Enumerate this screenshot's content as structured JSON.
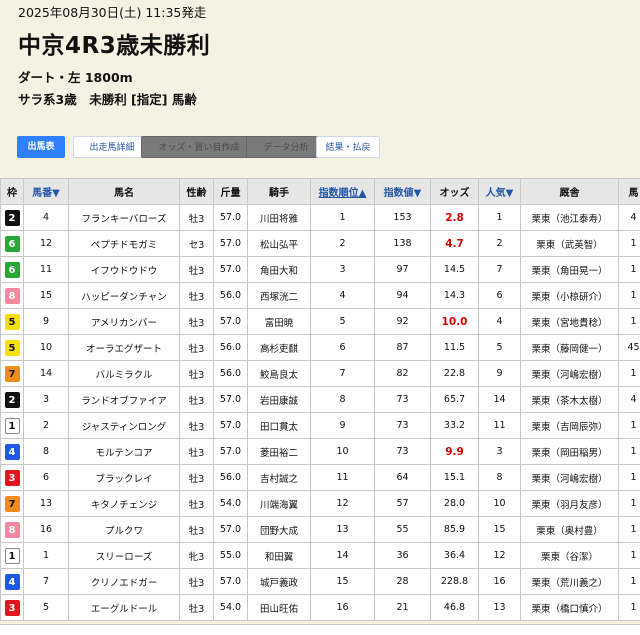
{
  "race": {
    "datetime": "2025年08月30日(土) 11:35発走",
    "title": "中京4R3歳未勝利",
    "course": "ダート・左 1800m",
    "conditions": "サラ系3歳　未勝利 [指定] 馬齢"
  },
  "tabs": [
    {
      "label": "出馬表"
    },
    {
      "label": "出走馬詳細"
    },
    {
      "label": "オッズ・買い目作成"
    },
    {
      "label": "データ分析"
    },
    {
      "label": "結果・払戻"
    }
  ],
  "columns": {
    "waku": "枠",
    "umaban": "馬番▼",
    "name": "馬名",
    "sexage": "性齢",
    "weight": "斤量",
    "jockey": "騎手",
    "index_rank": "指数順位▲",
    "index": "指数値▼",
    "odds": "オッズ",
    "pop": "人気▼",
    "trainer": "厩舎",
    "extra": "馬"
  },
  "colors": {
    "waku": {
      "1": {
        "bg": "#ffffff",
        "fg": "#111111",
        "border": "#888888"
      },
      "2": {
        "bg": "#111111",
        "fg": "#ffffff",
        "border": "#111111"
      },
      "3": {
        "bg": "#e8141c",
        "fg": "#ffffff",
        "border": "#e8141c"
      },
      "4": {
        "bg": "#1e5ae6",
        "fg": "#ffffff",
        "border": "#1e5ae6"
      },
      "5": {
        "bg": "#f7e011",
        "fg": "#111111",
        "border": "#f7e011"
      },
      "6": {
        "bg": "#25a834",
        "fg": "#ffffff",
        "border": "#25a834"
      },
      "7": {
        "bg": "#f08c1c",
        "fg": "#111111",
        "border": "#f08c1c"
      },
      "8": {
        "bg": "#f48aa0",
        "fg": "#ffffff",
        "border": "#f48aa0"
      }
    },
    "odds_hot": "#d40000",
    "accent": "#2f80ff"
  },
  "rows": [
    {
      "waku": "2",
      "umaban": "4",
      "name": "フランキーバローズ",
      "sexage": "牡3",
      "weight": "57.0",
      "jockey": "川田将雅",
      "rank": "1",
      "index": "153",
      "odds": "2.8",
      "hot": true,
      "pop": "1",
      "trainer": "栗東（池江泰寿）",
      "extra": "4"
    },
    {
      "waku": "6",
      "umaban": "12",
      "name": "ペプチドモガミ",
      "sexage": "セ3",
      "weight": "57.0",
      "jockey": "松山弘平",
      "rank": "2",
      "index": "138",
      "odds": "4.7",
      "hot": true,
      "pop": "2",
      "trainer": "栗東（武英智）",
      "extra": "1"
    },
    {
      "waku": "6",
      "umaban": "11",
      "name": "イフウドウドウ",
      "sexage": "牡3",
      "weight": "57.0",
      "jockey": "角田大和",
      "rank": "3",
      "index": "97",
      "odds": "14.5",
      "hot": false,
      "pop": "7",
      "trainer": "栗東（角田晃一）",
      "extra": "1"
    },
    {
      "waku": "8",
      "umaban": "15",
      "name": "ハッピーダンチャン",
      "sexage": "牡3",
      "weight": "56.0",
      "jockey": "西塚洸二",
      "rank": "4",
      "index": "94",
      "odds": "14.3",
      "hot": false,
      "pop": "6",
      "trainer": "栗東（小椋研介）",
      "extra": "1"
    },
    {
      "waku": "5",
      "umaban": "9",
      "name": "アメリカンバー",
      "sexage": "牡3",
      "weight": "57.0",
      "jockey": "富田暁",
      "rank": "5",
      "index": "92",
      "odds": "10.0",
      "hot": true,
      "pop": "4",
      "trainer": "栗東（宮地貴稔）",
      "extra": "1"
    },
    {
      "waku": "5",
      "umaban": "10",
      "name": "オーラエグザート",
      "sexage": "牡3",
      "weight": "56.0",
      "jockey": "高杉吏麒",
      "rank": "6",
      "index": "87",
      "odds": "11.5",
      "hot": false,
      "pop": "5",
      "trainer": "栗東（藤岡健一）",
      "extra": "45"
    },
    {
      "waku": "7",
      "umaban": "14",
      "name": "バルミラクル",
      "sexage": "牡3",
      "weight": "56.0",
      "jockey": "鮫島良太",
      "rank": "7",
      "index": "82",
      "odds": "22.8",
      "hot": false,
      "pop": "9",
      "trainer": "栗東（河嶋宏樹）",
      "extra": "1"
    },
    {
      "waku": "2",
      "umaban": "3",
      "name": "ランドオブファイア",
      "sexage": "牡3",
      "weight": "57.0",
      "jockey": "岩田康誠",
      "rank": "8",
      "index": "73",
      "odds": "65.7",
      "hot": false,
      "pop": "14",
      "trainer": "栗東（茶木太樹）",
      "extra": "4"
    },
    {
      "waku": "1",
      "umaban": "2",
      "name": "ジャスティンロング",
      "sexage": "牡3",
      "weight": "57.0",
      "jockey": "田口貫太",
      "rank": "9",
      "index": "73",
      "odds": "33.2",
      "hot": false,
      "pop": "11",
      "trainer": "栗東（吉岡辰弥）",
      "extra": "1"
    },
    {
      "waku": "4",
      "umaban": "8",
      "name": "モルテンコア",
      "sexage": "牡3",
      "weight": "57.0",
      "jockey": "菱田裕二",
      "rank": "10",
      "index": "73",
      "odds": "9.9",
      "hot": true,
      "pop": "3",
      "trainer": "栗東（岡田稲男）",
      "extra": "1"
    },
    {
      "waku": "3",
      "umaban": "6",
      "name": "ブラックレイ",
      "sexage": "牡3",
      "weight": "56.0",
      "jockey": "吉村誠之",
      "rank": "11",
      "index": "64",
      "odds": "15.1",
      "hot": false,
      "pop": "8",
      "trainer": "栗東（河嶋宏樹）",
      "extra": "1"
    },
    {
      "waku": "7",
      "umaban": "13",
      "name": "キタノチェンジ",
      "sexage": "牡3",
      "weight": "54.0",
      "jockey": "川端海翼",
      "rank": "12",
      "index": "57",
      "odds": "28.0",
      "hot": false,
      "pop": "10",
      "trainer": "栗東（羽月友彦）",
      "extra": "1"
    },
    {
      "waku": "8",
      "umaban": "16",
      "name": "プルクワ",
      "sexage": "牡3",
      "weight": "57.0",
      "jockey": "団野大成",
      "rank": "13",
      "index": "55",
      "odds": "85.9",
      "hot": false,
      "pop": "15",
      "trainer": "栗東（奥村豊）",
      "extra": "1"
    },
    {
      "waku": "1",
      "umaban": "1",
      "name": "スリーローズ",
      "sexage": "牝3",
      "weight": "55.0",
      "jockey": "和田翼",
      "rank": "14",
      "index": "36",
      "odds": "36.4",
      "hot": false,
      "pop": "12",
      "trainer": "栗東（谷潔）",
      "extra": "1"
    },
    {
      "waku": "4",
      "umaban": "7",
      "name": "クリノエドガー",
      "sexage": "牡3",
      "weight": "57.0",
      "jockey": "城戸義政",
      "rank": "15",
      "index": "28",
      "odds": "228.8",
      "hot": false,
      "pop": "16",
      "trainer": "栗東（荒川義之）",
      "extra": "1"
    },
    {
      "waku": "3",
      "umaban": "5",
      "name": "エーグルドール",
      "sexage": "牡3",
      "weight": "54.0",
      "jockey": "田山旺佑",
      "rank": "16",
      "index": "21",
      "odds": "46.8",
      "hot": false,
      "pop": "13",
      "trainer": "栗東（橋口慎介）",
      "extra": "1"
    }
  ]
}
